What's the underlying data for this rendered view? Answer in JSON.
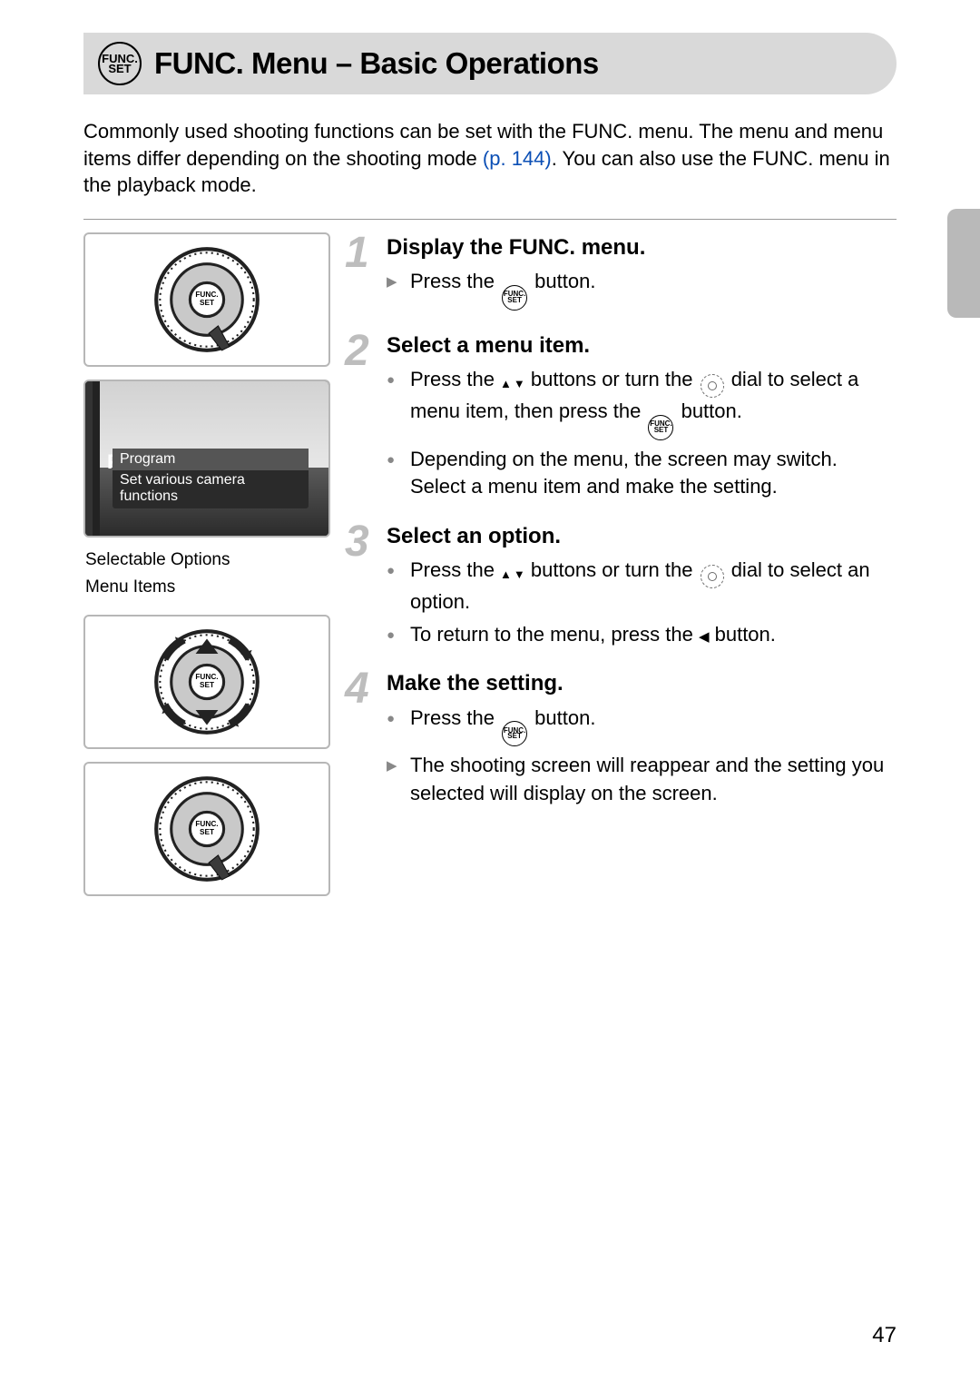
{
  "header": {
    "icon_top": "FUNC.",
    "icon_bot": "SET",
    "title": "FUNC. Menu – Basic Operations"
  },
  "intro": {
    "t1": "Commonly used shooting functions can be set with the FUNC. menu. The menu and menu items differ depending on the shooting mode ",
    "link": "(p. 144)",
    "t2": ". You can also use the FUNC. menu in the playback mode."
  },
  "panel2": {
    "program": "Program",
    "sub1": "Set various camera",
    "sub2": "functions",
    "P": "P",
    "p2": "p"
  },
  "captions": {
    "c1": "Selectable Options",
    "c2": "Menu Items"
  },
  "steps": [
    {
      "num": "1",
      "title": "Display the FUNC. menu.",
      "items": [
        {
          "mark": "tri",
          "pre": "Press the ",
          "inline": "funcset",
          "post": " button."
        }
      ]
    },
    {
      "num": "2",
      "title": "Select a menu item.",
      "items": [
        {
          "mark": "dot",
          "pre": "Press the ",
          "inline": "updown",
          "mid": " buttons or turn the ",
          "inline2": "dial",
          "mid2": " dial to select a menu item, then press the ",
          "inline3": "funcset",
          "post": " button."
        },
        {
          "mark": "dot",
          "pre": "Depending on the menu, the screen may switch. Select a menu item and make the setting."
        }
      ]
    },
    {
      "num": "3",
      "title": "Select an option.",
      "items": [
        {
          "mark": "dot",
          "pre": "Press the ",
          "inline": "updown",
          "mid": " buttons or turn the ",
          "inline2": "dial",
          "post": " dial to select an option."
        },
        {
          "mark": "dot",
          "pre": "To return to the menu, press the ",
          "inline": "leftarr",
          "post": " button."
        }
      ]
    },
    {
      "num": "4",
      "title": "Make the setting.",
      "items": [
        {
          "mark": "dot",
          "pre": "Press the ",
          "inline": "funcset",
          "post": " button."
        },
        {
          "mark": "tri",
          "pre": "The shooting screen will reappear and the setting you selected will display on the screen."
        }
      ]
    }
  ],
  "page_number": "47"
}
